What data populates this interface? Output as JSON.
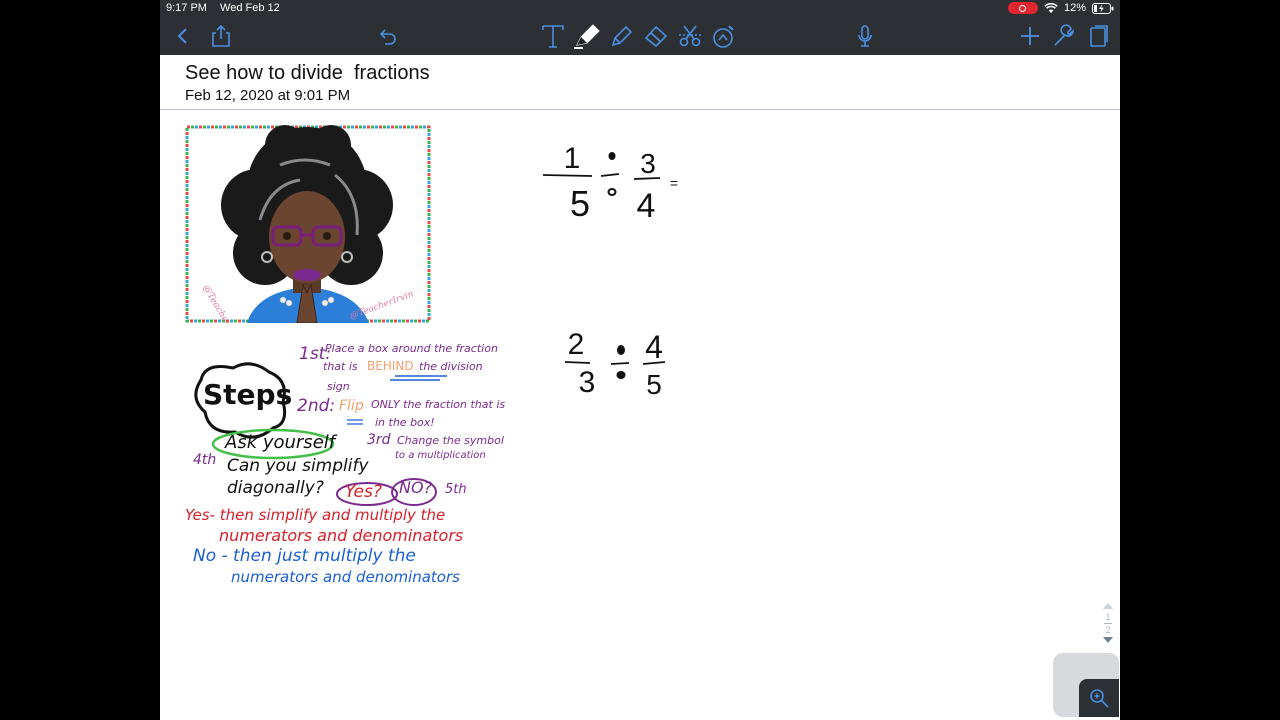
{
  "status_bar": {
    "time": "9:17 PM",
    "date": "Wed Feb 12",
    "battery": "12%"
  },
  "toolbar": {
    "left": [
      "back-icon",
      "share-icon",
      "undo-icon"
    ],
    "tools": [
      "text-tool-icon",
      "pen-tool-icon",
      "highlighter-tool-icon",
      "eraser-tool-icon",
      "lasso-tool-icon",
      "image-tool-icon"
    ],
    "right": [
      "microphone-icon",
      "add-icon",
      "settings-icon",
      "pages-icon"
    ]
  },
  "document": {
    "title": "See how to divide  fractions",
    "date": "Feb 12, 2020 at 9:01 PM"
  },
  "problems": [
    {
      "numerator1": "1",
      "denominator1": "5",
      "operator": "÷",
      "numerator2": "3",
      "denominator2": "4",
      "equals": "="
    },
    {
      "numerator1": "2",
      "denominator1": "3",
      "operator": "÷",
      "numerator2": "4",
      "denominator2": "5"
    }
  ],
  "steps_poster": {
    "heading": "Steps",
    "step1_num": "1st:",
    "step1_text_a": "Place a box around the fraction",
    "step1_text_b": "that is",
    "step1_behind": "BEHIND",
    "step1_text_c": "the division",
    "step1_text_d": "sign",
    "step2_num": "2nd:",
    "step2_flip": "Flip",
    "step2_text_a": "ONLY the fraction that is",
    "step2_text_b": "in the box!",
    "step3_num": "3rd",
    "step3_text_a": "Change the symbol",
    "step3_text_b": "to a multiplication",
    "step4_num": "4th",
    "step4_ask": "Ask yourself",
    "step4_text_a": "Can you simplify",
    "step4_text_b": "diagonally?",
    "yes": "Yes?",
    "no": "NO?",
    "step5_num": "5th",
    "yes_text_a": "Yes- then simplify and multiply the",
    "yes_text_b": "numerators and denominators",
    "no_text_a": "No - then just multiply the",
    "no_text_b": "numerators and denominators"
  },
  "pager": {
    "current": "1",
    "total": "2"
  },
  "colors": {
    "toolbar": "#2c2f34",
    "record": "#e0262e",
    "purple": "#7b2a90",
    "red": "#d8202a",
    "blue": "#1b5fd6",
    "orange": "#f0a070"
  }
}
